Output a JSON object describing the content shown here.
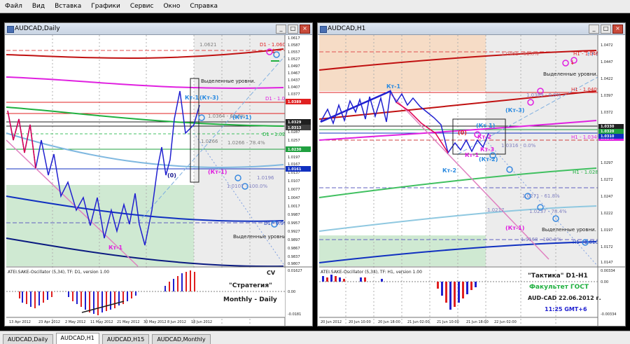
{
  "menu": [
    "Файл",
    "Вид",
    "Вставка",
    "Графики",
    "Сервис",
    "Окно",
    "Справка"
  ],
  "left": {
    "title": "AUDCAD,Daily",
    "price_scale": [
      "1.0617",
      "1.0587",
      "1.0557",
      "1.0527",
      "1.0497",
      "1.0467",
      "1.0437",
      "1.0407",
      "1.0377",
      "1.0347",
      "1.0317",
      "1.0287",
      "1.0257",
      "1.0227",
      "1.0197",
      "1.0167",
      "1.0137",
      "1.0107",
      "1.0077",
      "1.0047",
      "1.0017",
      "0.9987",
      "0.9957",
      "0.9927",
      "0.9897",
      "0.9867",
      "0.9837",
      "0.9807",
      "0.9777",
      "0.9747",
      "0.9717",
      "0.9687",
      "0.9657",
      "0.9627"
    ],
    "price_tags": [
      "1.0389",
      "1.0329",
      "1.0313",
      "1.0230",
      "1.0161"
    ],
    "level_labels": [
      "1.0621",
      "D1 - 1.0608",
      "D1 - 1.0458",
      "1.0364 - 61.8%",
      "D1 - 1.0289",
      "1.0266",
      "1.0266 - 78.4%",
      "1.0107 - 100.0%",
      "1.0196",
      "D1 - 0.9981"
    ],
    "wave_labels": [
      "Кт-1",
      "(Кт-3)",
      "(Кт-1)",
      "(Кт-1)",
      "(0)",
      "Кт-1"
    ],
    "notes": [
      "Выделенные уровни.",
      "Выделенные уровни."
    ],
    "osc_title": "ATEI.SAKE-Oscillator (5,34), TF: D1, version 1.00",
    "osc_cv": "CV",
    "osc_scale": [
      "0.01627",
      "0.00",
      "-0.0181"
    ],
    "strategy": [
      "\"Стратегия\"",
      "Monthly - Daily"
    ],
    "dates": [
      "13 Apr 2012",
      "23 Apr 2012",
      "2 May 2012",
      "11 May 2012",
      "21 May 2012",
      "30 May 2012",
      "8 Jun 2012",
      "18 Jun 2012"
    ]
  },
  "right": {
    "title": "AUDCAD,H1",
    "price_scale": [
      "1.0472",
      "1.0447",
      "1.0422",
      "1.0397",
      "1.0372",
      "1.0347",
      "1.0322",
      "1.0297",
      "1.0272",
      "1.0247",
      "1.0222",
      "1.0197",
      "1.0172",
      "1.0147",
      "1.0122"
    ],
    "price_tags": [
      "1.0349",
      "1.0330",
      "1.0320",
      "1.0310"
    ],
    "level_labels": [
      "1.0461 - 61.8%",
      "H1 - 1.0469",
      "H1 - 1.0409",
      "1.0389 - 0.0%",
      "H1 - 1.0349",
      "1.0316 - 0.0%",
      "H1 - 1.0289",
      "1.0271 - 61.8%",
      "1.0237 - 78.4%",
      "1.0217",
      "1.0168 - 100.0%",
      "H1 - 1.0169"
    ],
    "wave_labels": [
      "Кт-1",
      "(Кт-3)",
      "(Кт-1)",
      "(0)",
      "Кт-2",
      "Кт-1",
      "Кт-3",
      "(Кт-2)",
      "Кт-2",
      "(Кт-1)"
    ],
    "notes": [
      "Выделенные уровни.",
      "Выделенные уровни."
    ],
    "osc_title": "ATEI.SAKE-Oscillator (5,34), TF: H1, version 1.00",
    "osc_scale": [
      "0.00334",
      "0.00",
      "-0.00334"
    ],
    "tactic": [
      "\"Тактика\"  D1-H1",
      "Факультет ГОСТ",
      "AUD-CAD  22.06.2012 г.",
      "11:25  GMT+6"
    ],
    "dates": [
      "20 Jun 2012",
      "20 Jun 10:00",
      "20 Jun 18:00",
      "21 Jun 02:00",
      "21 Jun 10:00",
      "21 Jun 18:00",
      "22 Jun 02:00"
    ]
  },
  "tabs": [
    "AUDCAD,Daily",
    "AUDCAD,H1",
    "AUDCAD,H15",
    "AUDCAD,Monthly"
  ],
  "colors": {
    "bull": "#1010d0",
    "bear": "#e00020",
    "accent_green": "#20b040",
    "magenta": "#e020e0",
    "red": "#d02020",
    "blue_light": "#2a8ae0"
  }
}
